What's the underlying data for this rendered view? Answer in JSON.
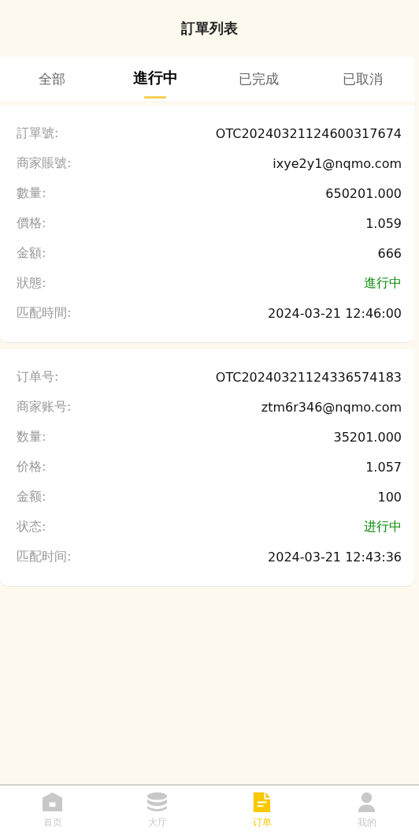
{
  "header": {
    "title": "訂單列表"
  },
  "tabs": [
    {
      "label": "全部",
      "selected": false
    },
    {
      "label": "進行中",
      "selected": true
    },
    {
      "label": "已完成",
      "selected": false
    },
    {
      "label": "已取消",
      "selected": false
    }
  ],
  "orders": [
    {
      "fields": [
        {
          "label": "訂單號:",
          "value": "OTC20240321124600317674",
          "kind": "text"
        },
        {
          "label": "商家賬號:",
          "value": "ixye2y1@nqmo.com",
          "kind": "text"
        },
        {
          "label": "數量:",
          "value": "650201.000",
          "kind": "text"
        },
        {
          "label": "價格:",
          "value": "1.059",
          "kind": "text"
        },
        {
          "label": "金額:",
          "value": "666",
          "kind": "text"
        },
        {
          "label": "狀態:",
          "value": "進行中",
          "kind": "status"
        },
        {
          "label": "匹配時間:",
          "value": "2024-03-21 12:46:00",
          "kind": "text"
        }
      ]
    },
    {
      "fields": [
        {
          "label": "订单号:",
          "value": "OTC20240321124336574183",
          "kind": "text"
        },
        {
          "label": "商家账号:",
          "value": "ztm6r346@nqmo.com",
          "kind": "text"
        },
        {
          "label": "数量:",
          "value": "35201.000",
          "kind": "text"
        },
        {
          "label": "价格:",
          "value": "1.057",
          "kind": "text"
        },
        {
          "label": "金额:",
          "value": "100",
          "kind": "text"
        },
        {
          "label": "状态:",
          "value": "进行中",
          "kind": "status"
        },
        {
          "label": "匹配时间:",
          "value": "2024-03-21 12:43:36",
          "kind": "text"
        }
      ]
    }
  ],
  "bottom_nav": [
    {
      "label": "首页",
      "kind": "home",
      "selected": false
    },
    {
      "label": "大厅",
      "kind": "coins",
      "selected": false
    },
    {
      "label": "订单",
      "kind": "document",
      "selected": true
    },
    {
      "label": "我的",
      "kind": "person",
      "selected": false
    }
  ]
}
